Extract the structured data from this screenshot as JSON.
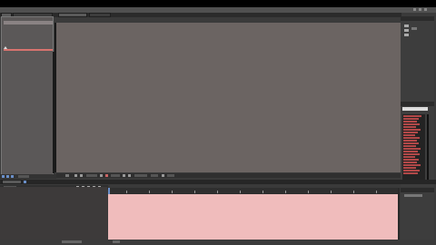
{
  "window": {
    "title": "",
    "colors": {
      "background": "#3a3a3a",
      "viewer": "#6b6462",
      "project_panel": "#5b5858",
      "timeline_region": "#f0bcbc",
      "selection": "#d8736e",
      "effects_highlight": "#b14848"
    }
  },
  "top_panel": {
    "tabs": [
      {
        "label": "",
        "icon": "folder-icon"
      },
      {
        "label": ""
      },
      {
        "label": ""
      },
      {
        "label": ""
      }
    ]
  },
  "project_panel": {
    "items": [
      {
        "label": ""
      }
    ]
  },
  "viewer": {
    "status_items": [
      "",
      "",
      "",
      "",
      "",
      ""
    ]
  },
  "right_panel": {
    "header": "",
    "effects_items": [
      "",
      "",
      "",
      "",
      "",
      "",
      "",
      "",
      "",
      "",
      "",
      "",
      "",
      "",
      "",
      "",
      "",
      "",
      "",
      "",
      "",
      ""
    ]
  },
  "timeline": {
    "header": "",
    "track_labels": [
      ""
    ]
  },
  "footer": {
    "items": [
      "",
      ""
    ]
  }
}
